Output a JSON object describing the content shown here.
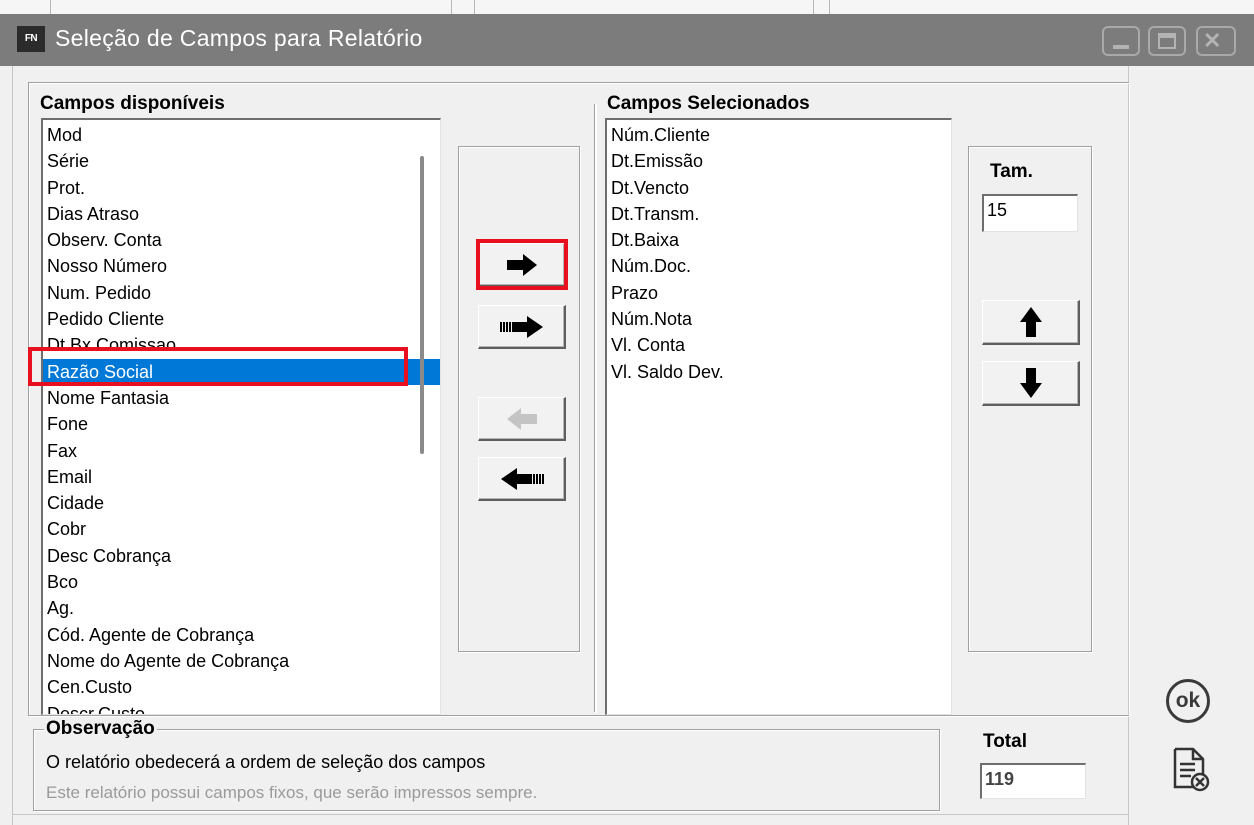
{
  "window": {
    "icon_text": "FN",
    "title": "Seleção de Campos para Relatório"
  },
  "available": {
    "label": "Campos disponíveis",
    "items": [
      "Mod",
      "Série",
      "Prot.",
      "Dias Atraso",
      "Observ. Conta",
      "Nosso Número",
      "Num. Pedido",
      "Pedido Cliente",
      "Dt.Bx.Comissao",
      "Razão Social",
      "Nome Fantasia",
      "Fone",
      "Fax",
      "Email",
      "Cidade",
      "Cobr",
      "Desc Cobrança",
      "Bco",
      "Ag.",
      "Cód. Agente de Cobrança",
      "Nome do Agente de Cobrança",
      "Cen.Custo",
      "Descr.Custo"
    ],
    "selected_item": "Razão Social"
  },
  "selected": {
    "label": "Campos Selecionados",
    "items": [
      "Núm.Cliente",
      "Dt.Emissão",
      "Dt.Vencto",
      "Dt.Transm.",
      "Dt.Baixa",
      "Núm.Doc.",
      "Prazo",
      "Núm.Nota",
      "Vl. Conta",
      "Vl. Saldo Dev."
    ]
  },
  "size": {
    "label": "Tam.",
    "value": "15"
  },
  "observation": {
    "label": "Observação",
    "line1": "O relatório obedecerá a ordem de seleção dos campos",
    "line2": "Este relatório possui campos fixos, que serão impressos sempre."
  },
  "total": {
    "label": "Total",
    "value": "119"
  },
  "ok_label": "ok",
  "colors": {
    "titlebar": "#7c7c7c",
    "selection": "#0078d7",
    "highlight_border": "#e8101e"
  }
}
